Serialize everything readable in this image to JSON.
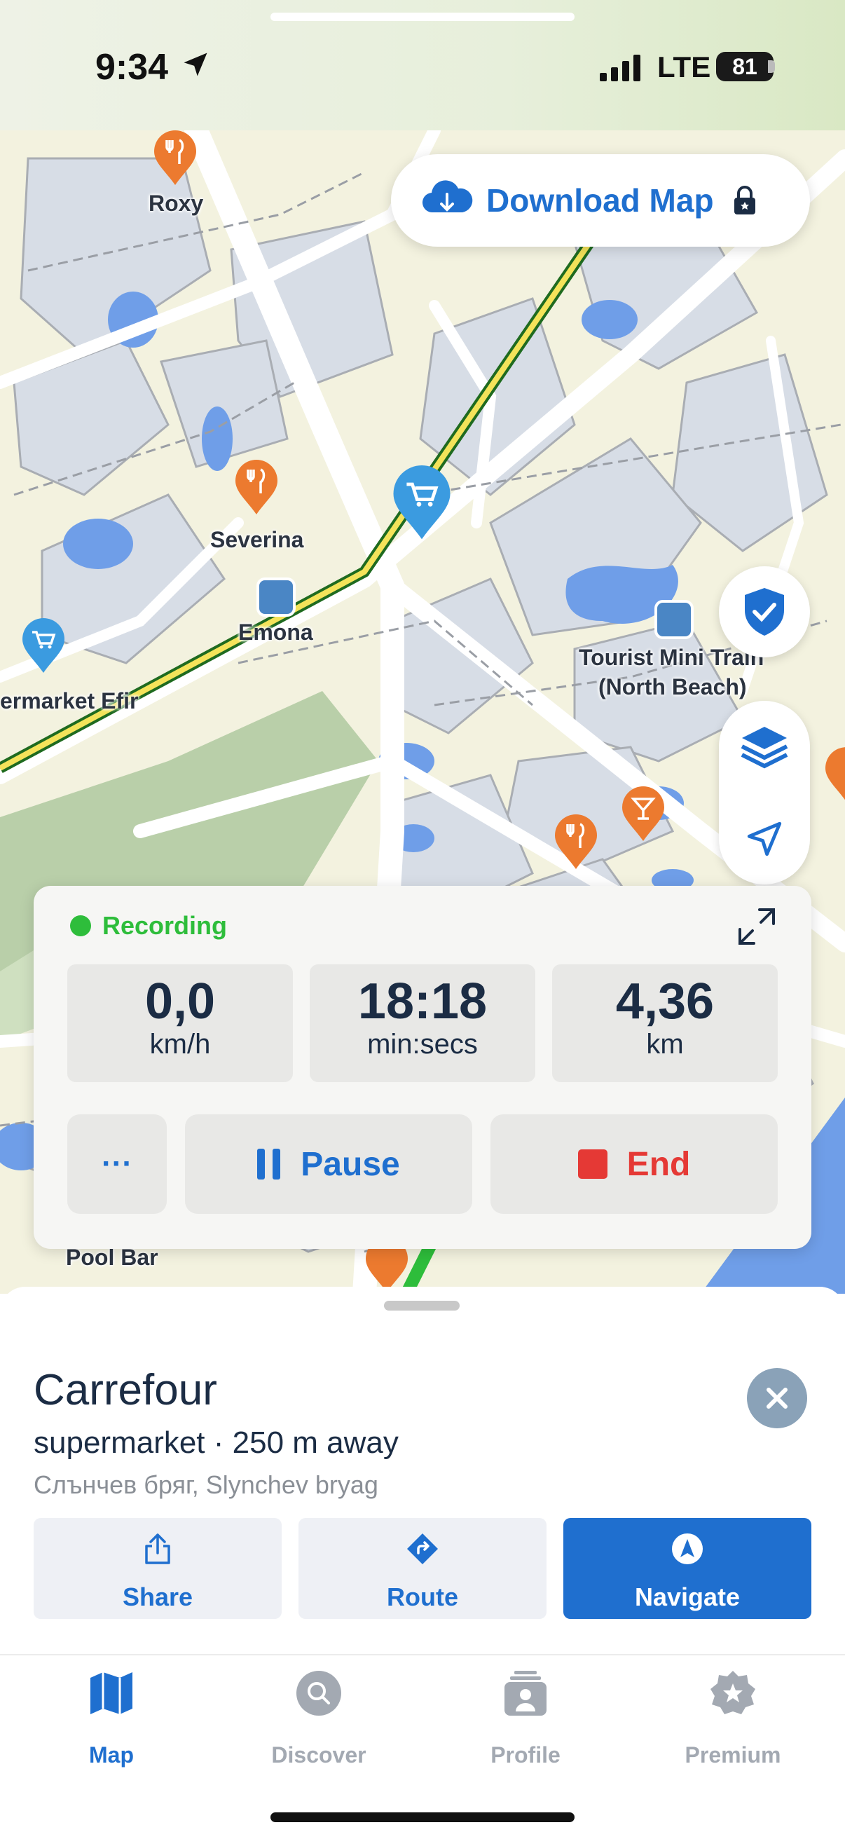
{
  "status_bar": {
    "time": "9:34",
    "network": "LTE",
    "battery": "81"
  },
  "map": {
    "download_map_label": "Download Map",
    "labels": {
      "roxy": "Roxy",
      "severina": "Severina",
      "emona": "Emona",
      "supermarket": "ermarket Efir",
      "tourist_train_1": "Tourist Mini Train",
      "tourist_train_2": "(North Beach)",
      "pool_bar": "Pool Bar"
    }
  },
  "recording": {
    "status": "Recording",
    "speed_value": "0,0",
    "speed_unit": "km/h",
    "time_value": "18:18",
    "time_unit": "min:secs",
    "distance_value": "4,36",
    "distance_unit": "km",
    "more_label": "···",
    "pause_label": "Pause",
    "end_label": "End"
  },
  "place": {
    "name": "Carrefour",
    "subtitle": "supermarket · 250 m away",
    "address": "Слънчев бряг, Slynchev bryag",
    "actions": {
      "share": "Share",
      "route": "Route",
      "navigate": "Navigate"
    }
  },
  "tabs": {
    "map": "Map",
    "discover": "Discover",
    "profile": "Profile",
    "premium": "Premium"
  },
  "colors": {
    "accent": "#1f6fcf",
    "recording": "#2ebd3b",
    "end": "#e53935",
    "poi_orange": "#ec7a2f",
    "poi_blue": "#3b9be0"
  }
}
